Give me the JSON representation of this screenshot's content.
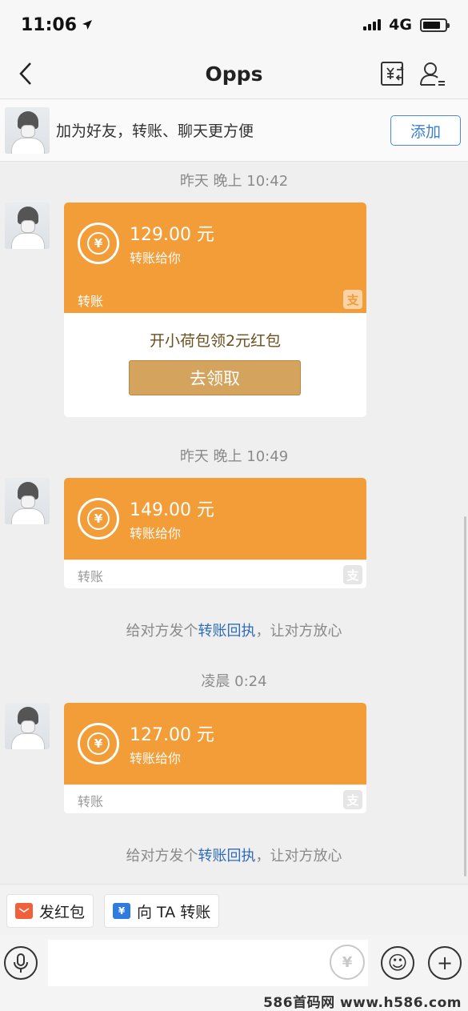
{
  "status_bar": {
    "time": "11:06",
    "network": "4G",
    "battery_level": 0.8
  },
  "nav": {
    "title": "Opps",
    "back_icon": "chevron-left-icon",
    "transfer_icon": "transfer-list-icon",
    "user_icon": "user-profile-icon"
  },
  "friend_banner": {
    "text": "加为好友，转账、聊天更方便",
    "button_label": "添加"
  },
  "messages": [
    {
      "timestamp": "昨天 晚上 10:42",
      "amount": "129.00 元",
      "subtitle": "转账给你",
      "label": "转账",
      "promo_text": "开小荷包领2元红包",
      "promo_button": "去领取"
    },
    {
      "timestamp": "昨天 晚上 10:49",
      "amount": "149.00 元",
      "subtitle": "转账给你",
      "label": "转账"
    },
    {
      "timestamp": "凌晨 0:24",
      "amount": "127.00 元",
      "subtitle": "转账给你",
      "label": "转账"
    }
  ],
  "receipt_note": {
    "prefix": "给对方发个",
    "link": "转账回执",
    "suffix": "，让对方放心"
  },
  "shortcuts": {
    "red_packet": "发红包",
    "transfer": "向 TA 转账"
  },
  "input_bar": {
    "placeholder": "",
    "voice_icon": "microphone-icon",
    "yuan_icon": "yuan-icon",
    "emoji_icon": "emoji-icon",
    "plus_icon": "plus-icon"
  },
  "icon_glyphs": {
    "yuan": "¥",
    "alipay": "支",
    "emoji": "☺",
    "plus": "+"
  },
  "watermark": "586首码网 www.h586.com",
  "colors": {
    "card_orange": "#f29d38",
    "link_blue": "#2f6db8",
    "promo_gold": "#d4a45e"
  }
}
